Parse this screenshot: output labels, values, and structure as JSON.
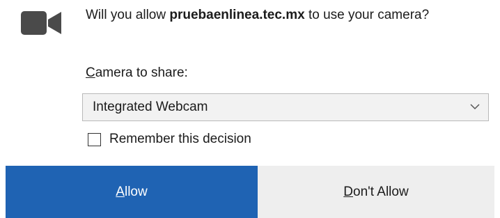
{
  "prompt": {
    "prefix": "Will you allow ",
    "host": "pruebaenlinea.tec.mx",
    "suffix": " to use your camera?"
  },
  "camera_select": {
    "label_access_key": "C",
    "label_rest": "amera to share:",
    "selected_value": "Integrated Webcam"
  },
  "remember": {
    "label": "Remember this decision",
    "checked": false
  },
  "buttons": {
    "allow_access_key": "A",
    "allow_rest": "llow",
    "deny_access_key": "D",
    "deny_rest": "on't Allow"
  },
  "icons": {
    "camera": "video-camera-icon",
    "dropdown": "chevron-down-icon"
  },
  "colors": {
    "allow_button_bg": "#1f63b3",
    "deny_button_bg": "#eeeeee",
    "icon_gray": "#4a4a4a"
  }
}
